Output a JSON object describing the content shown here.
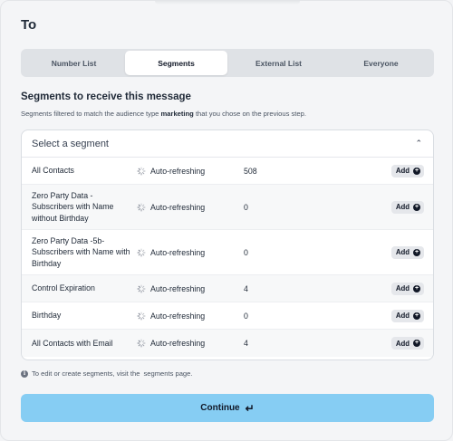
{
  "header": {
    "title": "To"
  },
  "tabs": [
    {
      "label": "Number List",
      "active": false
    },
    {
      "label": "Segments",
      "active": true
    },
    {
      "label": "External List",
      "active": false
    },
    {
      "label": "Everyone",
      "active": false
    }
  ],
  "section": {
    "title": "Segments to receive this message",
    "subtitle_before": "Segments filtered to match the audience type",
    "subtitle_bold": "marketing",
    "subtitle_after": "that you chose on the previous step."
  },
  "select": {
    "placeholder": "Select a segment",
    "chevron_icon": "chevron-up-icon"
  },
  "segments": [
    {
      "name": "All Contacts",
      "status": "Auto-refreshing",
      "count": "508",
      "add_label": "Add"
    },
    {
      "name": "Zero Party Data - Subscribers with Name without Birthday",
      "status": "Auto-refreshing",
      "count": "0",
      "add_label": "Add"
    },
    {
      "name": "Zero Party Data -5b- Subscribers with Name with Birthday",
      "status": "Auto-refreshing",
      "count": "0",
      "add_label": "Add"
    },
    {
      "name": "Control Expiration",
      "status": "Auto-refreshing",
      "count": "4",
      "add_label": "Add"
    },
    {
      "name": "Birthday",
      "status": "Auto-refreshing",
      "count": "0",
      "add_label": "Add"
    },
    {
      "name": "All Contacts with Email",
      "status": "Auto-refreshing",
      "count": "4",
      "add_label": "Add"
    }
  ],
  "info": {
    "text": "To edit or create segments, visit the",
    "link": "segments page."
  },
  "continue": {
    "label": "Continue",
    "icon": "arrow-down-turn-icon"
  },
  "colors": {
    "accent": "#86cdf3",
    "panel_bg": "#ffffff",
    "page_bg": "#f4f5f7"
  }
}
